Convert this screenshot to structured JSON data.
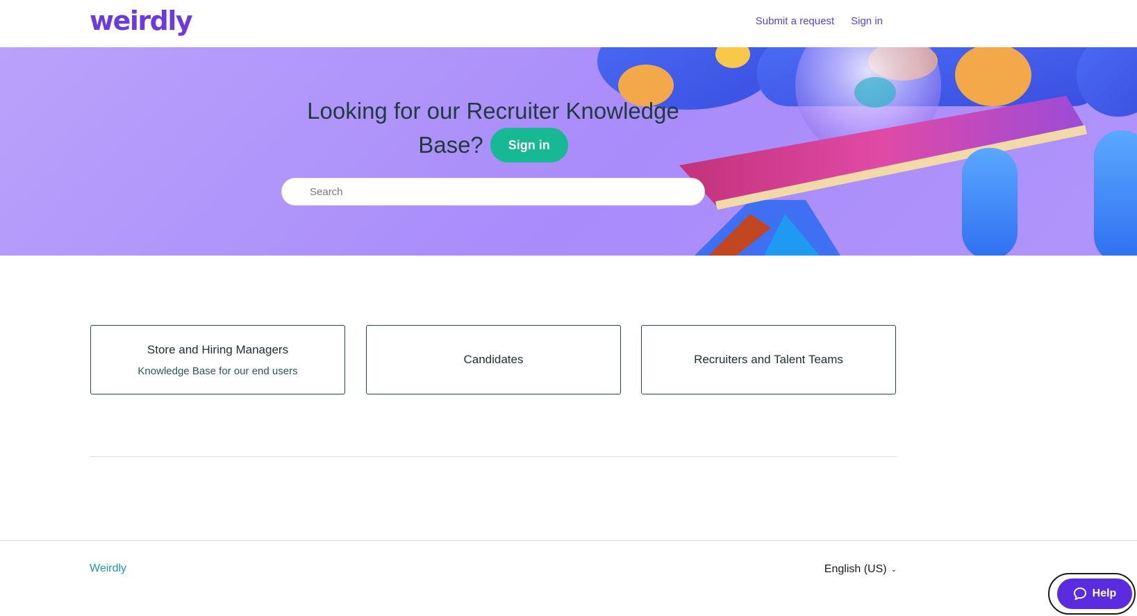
{
  "header": {
    "logo": "weirdly",
    "nav": {
      "submit_request": "Submit a request",
      "sign_in": "Sign in"
    }
  },
  "hero": {
    "title_line1": "Looking for our Recruiter Knowledge",
    "title_line2": "Base?",
    "sign_in_button": "Sign in",
    "search_placeholder": "Search"
  },
  "categories": [
    {
      "title": "Store and Hiring Managers",
      "description": "Knowledge Base for our end users"
    },
    {
      "title": "Candidates"
    },
    {
      "title": "Recruiters and Talent Teams"
    }
  ],
  "footer": {
    "brand": "Weirdly",
    "language": "English (US)"
  },
  "help_widget": {
    "label": "Help"
  },
  "colors": {
    "brand_purple": "#6b3ae0",
    "accent_green": "#17b994",
    "hero_bg": "#b09afb",
    "help_purple": "#5b2be0"
  }
}
